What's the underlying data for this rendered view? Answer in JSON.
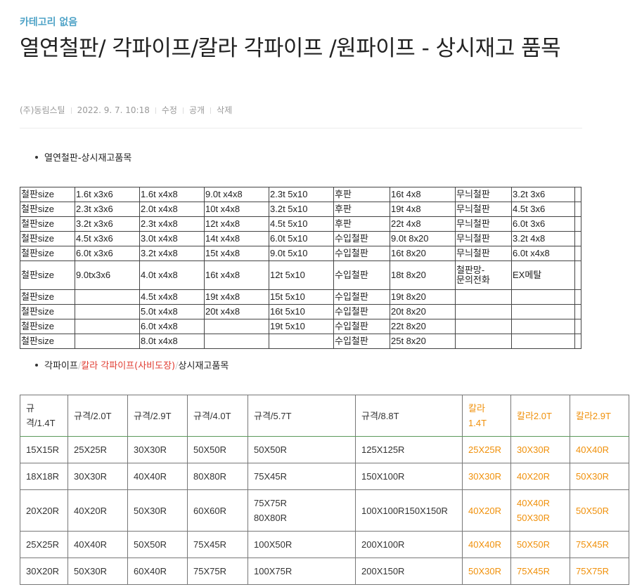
{
  "category": "카테고리 없음",
  "title": "열연철판/ 각파이프/칼라 각파이프 /원파이프 - 상시재고 품목",
  "meta": {
    "author": "(주)동림스틸",
    "date": "2022. 9. 7. 10:18",
    "edit": "수정",
    "visibility": "공개",
    "delete": "삭제"
  },
  "bullet1": "열연철판-상시재고품목",
  "bullet2": {
    "part1": "각파이프",
    "sep1": "/",
    "part2": "칼라 각파이프(사비도장)",
    "sep2": "/",
    "part3": "상시재고품목"
  },
  "table1": {
    "rows": [
      [
        "철판size",
        "1.6t x3x6",
        "1.6t x4x8",
        "9.0t x4x8",
        "2.3t 5x10",
        "후판",
        "16t 4x8",
        "무늬철판",
        "3.2t 3x6",
        ""
      ],
      [
        "철판size",
        "2.3t x3x6",
        "2.0t x4x8",
        "10t x4x8",
        "3.2t 5x10",
        "후판",
        "19t 4x8",
        "무늬철판",
        "4.5t 3x6",
        ""
      ],
      [
        "철판size",
        "3.2t x3x6",
        "2.3t x4x8",
        "12t x4x8",
        "4.5t 5x10",
        "후판",
        "22t 4x8",
        "무늬철판",
        "6.0t 3x6",
        ""
      ],
      [
        "철판size",
        "4.5t x3x6",
        "3.0t x4x8",
        "14t x4x8",
        "6.0t 5x10",
        "수입철판",
        "9.0t 8x20",
        "무늬철판",
        "3.2t 4x8",
        ""
      ],
      [
        "철판size",
        "6.0t x3x6",
        "3.2t x4x8",
        "15t x4x8",
        "9.0t 5x10",
        "수입철판",
        "16t 8x20",
        "무늬철판",
        "6.0t x4x8",
        ""
      ],
      [
        "철판size",
        "9.0tx3x6",
        "4.0t x4x8",
        "16t x4x8",
        "12t 5x10",
        "수입철판",
        "18t 8x20",
        "철판망-\n문의전화",
        "EX메탈",
        ""
      ],
      [
        "철판size",
        "",
        "4.5t x4x8",
        "19t x4x8",
        "15t 5x10",
        "수입철판",
        "19t 8x20",
        "",
        "",
        ""
      ],
      [
        "철판size",
        "",
        "5.0t x4x8",
        "20t x4x8",
        "16t 5x10",
        "수입철판",
        "20t 8x20",
        "",
        "",
        ""
      ],
      [
        "철판size",
        "",
        "6.0t x4x8",
        "",
        "19t 5x10",
        "수입철판",
        "22t 8x20",
        "",
        "",
        ""
      ],
      [
        "철판size",
        "",
        "8.0t x4x8",
        "",
        "",
        "수입철판",
        "25t 8x20",
        "",
        "",
        ""
      ]
    ]
  },
  "table2": {
    "headers": [
      "규\n격/1.4T",
      "규격/2.0T",
      "규격/2.9T",
      "규격/4.0T",
      "규격/5.7T",
      "규격/8.8T",
      "칼라\n1.4T",
      "칼라2.0T",
      "칼라2.9T"
    ],
    "rows": [
      [
        "15X15R",
        "25X25R",
        "30X30R",
        "50X50R",
        "50X50R",
        "125X125R",
        "25X25R",
        "30X30R",
        "40X40R"
      ],
      [
        "18X18R",
        "30X30R",
        "40X40R",
        "80X80R",
        "75X45R",
        "150X100R",
        "30X30R",
        "40X20R",
        "50X30R"
      ],
      [
        "20X20R",
        "40X20R",
        "50X30R",
        "60X60R",
        "75X75R\n80X80R",
        "100X100R150X150R",
        "40X20R",
        "40X40R\n50X30R",
        "50X50R"
      ],
      [
        "25X25R",
        "40X40R",
        "50X50R",
        "75X45R",
        "100X50R",
        "200X100R",
        "40X40R",
        "50X50R",
        "75X45R"
      ],
      [
        "30X20R",
        "50X30R",
        "60X40R",
        "75X75R",
        "100X75R",
        "200X150R",
        "50X30R",
        "75X45R",
        "75X75R"
      ]
    ]
  },
  "colors": {
    "category": "#4fa3c7",
    "accent_red": "#e03c31",
    "accent_orange": "#f0900a"
  }
}
